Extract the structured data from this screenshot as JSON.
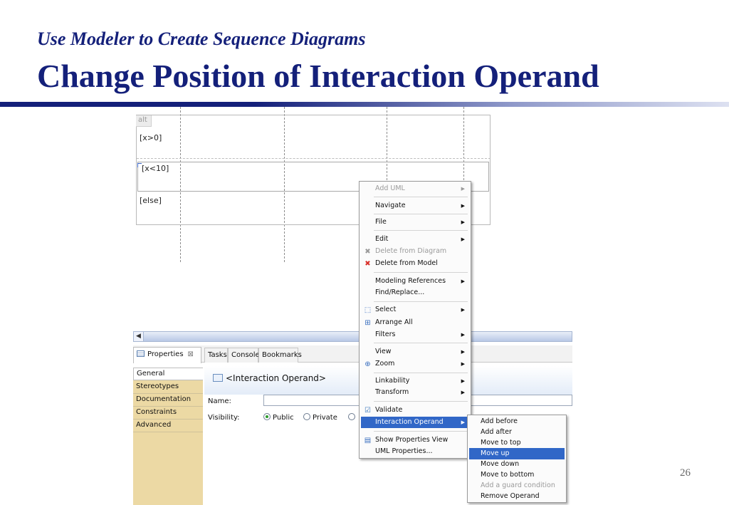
{
  "slide": {
    "subtitle": "Use Modeler to Create Sequence Diagrams",
    "title": "Change Position of Interaction Operand",
    "page_number": "26"
  },
  "diagram": {
    "fragment_keyword": "alt",
    "operands": [
      "[x>0]",
      "[x<10]",
      "[else]"
    ]
  },
  "views": {
    "tabs": [
      {
        "label": "Properties",
        "close": "⊠"
      },
      {
        "label": "Tasks"
      },
      {
        "label": "Console"
      },
      {
        "label": "Bookmarks"
      }
    ]
  },
  "properties": {
    "sections": [
      "General",
      "Stereotypes",
      "Documentation",
      "Constraints",
      "Advanced"
    ],
    "element_title": "<Interaction Operand>",
    "name_label": "Name:",
    "name_value": "",
    "visibility_label": "Visibility:",
    "visibility_options": [
      "Public",
      "Private"
    ],
    "visibility_selected": "Public"
  },
  "context_menu": {
    "items": [
      {
        "label": "Add UML",
        "submenu": true,
        "disabled": true
      },
      {
        "label": "Navigate",
        "submenu": true
      },
      {
        "label": "File",
        "submenu": true
      },
      {
        "label": "Edit",
        "submenu": true
      },
      {
        "label": "Delete from Diagram",
        "icon": "delete-gray-icon",
        "disabled": true
      },
      {
        "label": "Delete from Model",
        "icon": "delete-red-icon"
      },
      {
        "label": "Modeling References",
        "submenu": true
      },
      {
        "label": "Find/Replace..."
      },
      {
        "label": "Select",
        "icon": "select-icon",
        "submenu": true
      },
      {
        "label": "Arrange All",
        "icon": "arrange-icon"
      },
      {
        "label": "Filters",
        "submenu": true
      },
      {
        "label": "View",
        "submenu": true
      },
      {
        "label": "Zoom",
        "icon": "zoom-icon",
        "submenu": true
      },
      {
        "label": "Linkability",
        "submenu": true
      },
      {
        "label": "Transform",
        "submenu": true
      },
      {
        "label": "Validate",
        "icon": "validate-icon"
      },
      {
        "label": "Interaction Operand",
        "submenu": true,
        "highlighted": true
      },
      {
        "label": "Show Properties View",
        "icon": "properties-icon"
      },
      {
        "label": "UML Properties..."
      }
    ]
  },
  "submenu": {
    "items": [
      {
        "label": "Add before"
      },
      {
        "label": "Add after"
      },
      {
        "label": "Move to top"
      },
      {
        "label": "Move up",
        "highlighted": true
      },
      {
        "label": "Move down"
      },
      {
        "label": "Move to bottom"
      },
      {
        "label": "Add a guard condition",
        "disabled": true
      },
      {
        "label": "Remove Operand"
      }
    ]
  },
  "colors": {
    "title_blue": "#14207a",
    "menu_highlight": "#3167c7",
    "properties_sidebar": "#ecd9a4"
  }
}
